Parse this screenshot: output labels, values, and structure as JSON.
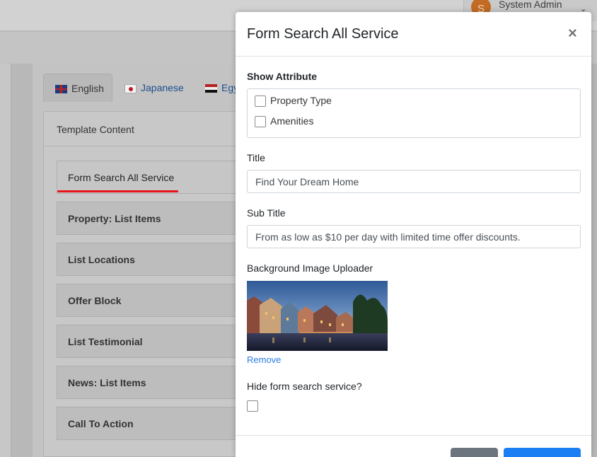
{
  "header": {
    "user_initial": "S",
    "user_name": "System Admin"
  },
  "language_tabs": [
    {
      "label": "English",
      "active": true
    },
    {
      "label": "Japanese",
      "active": false
    },
    {
      "label": "Egy",
      "active": false
    }
  ],
  "template": {
    "header": "Template Content",
    "items": [
      "Form Search All Service",
      "Property: List Items",
      "List Locations",
      "Offer Block",
      "List Testimonial",
      "News: List Items",
      "Call To Action"
    ]
  },
  "modal": {
    "title": "Form Search All Service",
    "close_symbol": "×",
    "show_attribute_label": "Show Attribute",
    "attributes": [
      "Property Type",
      "Amenities"
    ],
    "title_label": "Title",
    "title_value": "Find Your Dream Home",
    "subtitle_label": "Sub Title",
    "subtitle_value": "From as low as $10 per day with limited time offer discounts.",
    "bg_image_label": "Background Image Uploader",
    "remove_label": "Remove",
    "hide_label": "Hide form search service?"
  },
  "colors": {
    "accent_blue": "#1a7ff2",
    "active_underline": "#e8141b",
    "secondary_button": "#6c757d"
  }
}
